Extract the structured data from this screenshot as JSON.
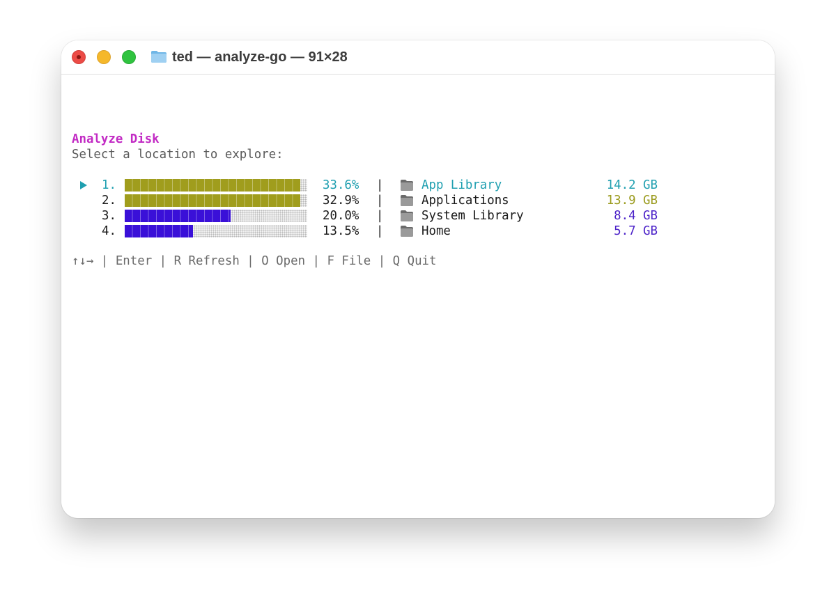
{
  "window": {
    "title": "ted — analyze-go — 91×28"
  },
  "terminal": {
    "heading": "Analyze Disk",
    "subheading": "Select a location to explore:",
    "rows": [
      {
        "index": "1.",
        "percent": "33.6%",
        "fraction": 0.96,
        "separator": "|",
        "name": "App Library",
        "size": "14.2 GB",
        "color": "#1f9fb0",
        "size_color": "#1f9fb0",
        "bar_color": "#a09d1d",
        "selected": true
      },
      {
        "index": "2.",
        "percent": "32.9%",
        "fraction": 0.96,
        "separator": "|",
        "name": "Applications",
        "size": "13.9 GB",
        "color": "#1a1a1a",
        "size_color": "#9a9a1c",
        "bar_color": "#a09d1d",
        "selected": false
      },
      {
        "index": "3.",
        "percent": "20.0%",
        "fraction": 0.58,
        "separator": "|",
        "name": "System Library",
        "size": "8.4 GB",
        "color": "#1a1a1a",
        "size_color": "#4a20c8",
        "bar_color": "#3a10d8",
        "selected": false
      },
      {
        "index": "4.",
        "percent": "13.5%",
        "fraction": 0.375,
        "separator": "|",
        "name": "Home",
        "size": "5.7 GB",
        "color": "#1a1a1a",
        "size_color": "#4a20c8",
        "bar_color": "#3a10d8",
        "selected": false
      }
    ],
    "hints": "↑↓→ | Enter | R Refresh | O Open | F File | Q Quit"
  },
  "icons": {
    "selection": "triangle-right-icon",
    "folder": "folder-icon"
  }
}
